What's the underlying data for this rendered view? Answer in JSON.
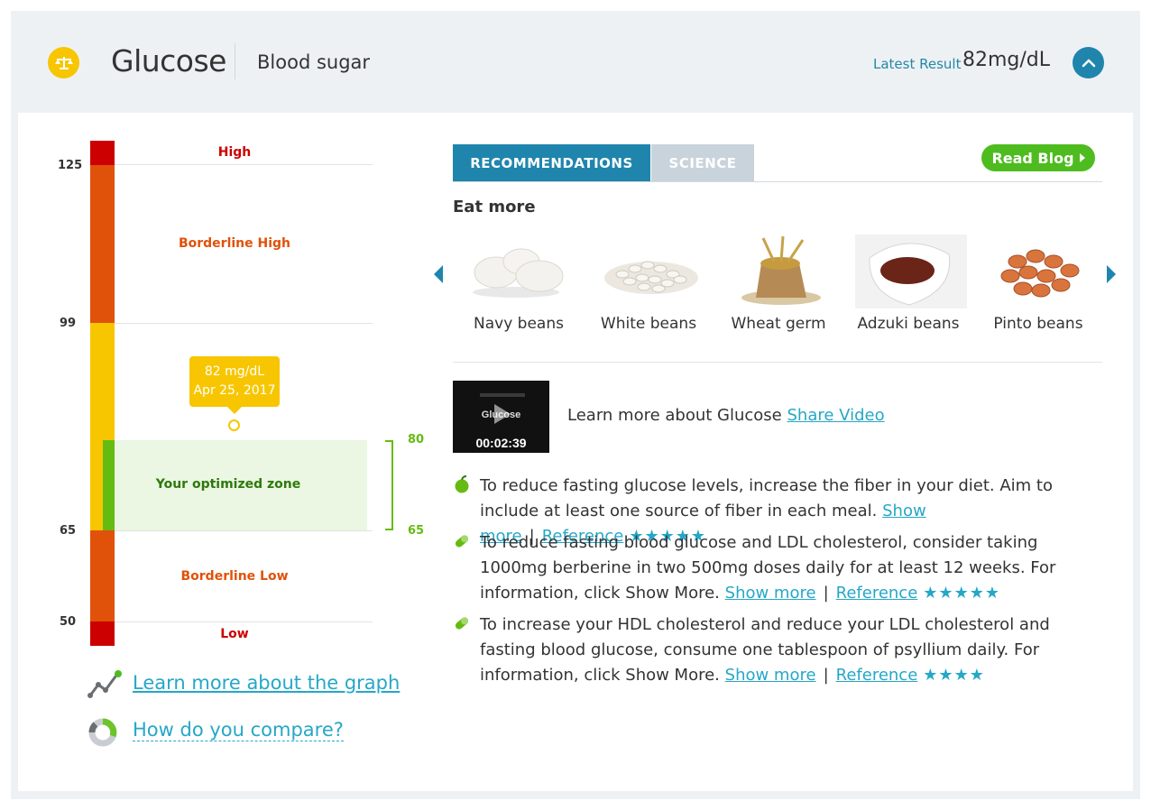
{
  "header": {
    "title": "Glucose",
    "subtitle": "Blood sugar",
    "latest_label": "Latest Result",
    "latest_value": "82mg/dL",
    "icon": "scale-icon",
    "collapse_icon": "chevron-up-icon"
  },
  "gauge": {
    "ticks": [
      "125",
      "99",
      "65",
      "50"
    ],
    "zones": {
      "high": "High",
      "borderline_high": "Borderline High",
      "optimized": "Your optimized zone",
      "borderline_low": "Borderline Low",
      "low": "Low"
    },
    "optimized_range": {
      "low": "65",
      "high": "80"
    },
    "result_value": "82 mg/dL",
    "result_date": "Apr 25, 2017",
    "colors": {
      "red": "#cc0000",
      "orange": "#e0520a",
      "yellow": "#f7c600",
      "green": "#66bb11",
      "optimized_bg": "#ebf6e3"
    }
  },
  "links": {
    "learn_graph": "Learn more about the graph",
    "compare": "How do you compare?"
  },
  "tabs": [
    {
      "label": "RECOMMENDATIONS",
      "active": true
    },
    {
      "label": "SCIENCE",
      "active": false
    }
  ],
  "read_blog": "Read Blog",
  "eat_more": {
    "heading": "Eat more",
    "foods": [
      "Navy beans",
      "White beans",
      "Wheat germ",
      "Adzuki beans",
      "Pinto beans"
    ]
  },
  "video": {
    "title": "Glucose",
    "duration": "00:02:39",
    "learn_text": "Learn more about Glucose",
    "share_label": "Share Video"
  },
  "recommendations": [
    {
      "icon": "apple-icon",
      "text": "To reduce fasting glucose levels, increase the fiber in your diet. Aim to include at least one source of fiber in each meal.",
      "show_more": "Show more",
      "reference": "Reference",
      "stars": "★★★★★"
    },
    {
      "icon": "pill-icon",
      "text": "To reduce fasting blood glucose and LDL cholesterol, consider taking 1000mg berberine in two 500mg doses daily for at least 12 weeks. For information, click Show More.",
      "show_more": "Show more",
      "reference": "Reference",
      "stars": "★★★★★"
    },
    {
      "icon": "pill-icon",
      "text": "To increase your HDL cholesterol and reduce your LDL cholesterol and fasting blood glucose, consume one tablespoon of psyllium daily. For information, click Show More.",
      "show_more": "Show more",
      "reference": "Reference",
      "stars": "★★★★"
    }
  ]
}
